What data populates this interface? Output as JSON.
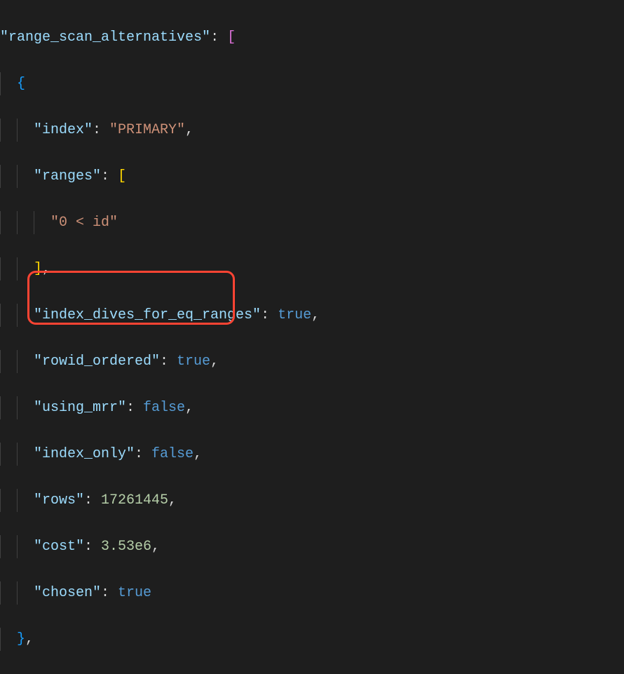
{
  "code": {
    "root_key": "\"range_scan_alternatives\"",
    "line1_open": "[",
    "line2_brace": "{",
    "line3_key": "\"index\"",
    "line3_val": "\"PRIMARY\"",
    "line4_key": "\"ranges\"",
    "line4_open": "[",
    "line5_val": "\"0 < id\"",
    "line6_close": "]",
    "line7_key": "\"index_dives_for_eq_ranges\"",
    "line7_val": "true",
    "line8_key": "\"rowid_ordered\"",
    "line8_val": "true",
    "line9_key": "\"using_mrr\"",
    "line9_val": "false",
    "line10_key": "\"index_only\"",
    "line10_val": "false",
    "line11_key": "\"rows\"",
    "line11_val": "17261445",
    "line12_key": "\"cost\"",
    "line12_val": "3.53e6",
    "line13_key": "\"chosen\"",
    "line13_val": "true",
    "line14_close": "}",
    "colon": ": ",
    "comma": ","
  }
}
